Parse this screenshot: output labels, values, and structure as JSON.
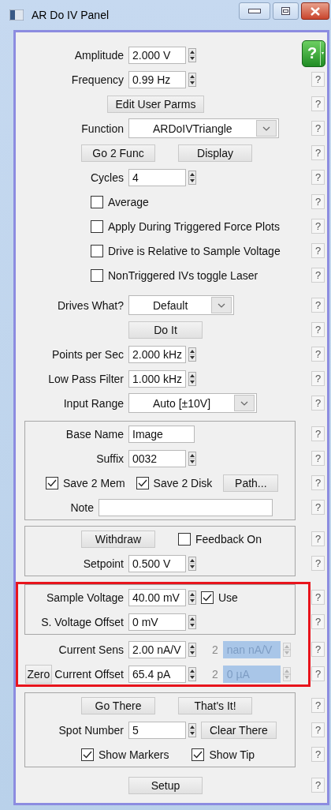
{
  "window": {
    "title": "AR Do IV Panel"
  },
  "blocks": [
    {
      "kind": "plain",
      "rows": [
        {
          "kind": "field",
          "lead": [
            {
              "kind": "label",
              "text": "Amplitude"
            }
          ],
          "items": [
            {
              "kind": "spin",
              "value": "2.000 V",
              "disabled": false
            }
          ],
          "help": {
            "kind": "green",
            "label": "?"
          }
        },
        {
          "kind": "field",
          "lead": [
            {
              "kind": "label",
              "text": "Frequency"
            }
          ],
          "items": [
            {
              "kind": "spin",
              "value": "0.99 Hz",
              "disabled": false
            }
          ],
          "help": {
            "kind": "small",
            "label": "?"
          }
        },
        {
          "kind": "center",
          "lead": [],
          "items": [
            {
              "kind": "button",
              "label": "Edit User Parms"
            }
          ],
          "help": {
            "kind": "small",
            "label": "?"
          }
        },
        {
          "kind": "field",
          "lead": [
            {
              "kind": "label",
              "text": "Function"
            }
          ],
          "items": [
            {
              "kind": "dropdown",
              "value": "ARDoIVTriangle"
            }
          ],
          "help": {
            "kind": "small",
            "label": "?"
          }
        },
        {
          "kind": "offset",
          "lead": [],
          "items": [
            {
              "kind": "button",
              "label": "Go 2 Func"
            },
            {
              "kind": "button",
              "label": "Display"
            }
          ],
          "help": {
            "kind": "small",
            "label": "?"
          }
        },
        {
          "kind": "field",
          "lead": [
            {
              "kind": "label",
              "text": "Cycles"
            }
          ],
          "items": [
            {
              "kind": "spin",
              "value": "4",
              "disabled": false
            }
          ],
          "help": {
            "kind": "small",
            "label": "?"
          }
        },
        {
          "kind": "check",
          "lead": [],
          "items": [
            {
              "kind": "checkbox",
              "label": "Average",
              "checked": false
            }
          ],
          "help": {
            "kind": "small",
            "label": "?"
          }
        },
        {
          "kind": "check",
          "lead": [],
          "items": [
            {
              "kind": "checkbox",
              "label": "Apply During Triggered Force Plots",
              "checked": false
            }
          ],
          "help": {
            "kind": "small",
            "label": "?"
          }
        },
        {
          "kind": "check",
          "lead": [],
          "items": [
            {
              "kind": "checkbox",
              "label": "Drive is Relative to Sample Voltage",
              "checked": false
            }
          ],
          "help": {
            "kind": "small",
            "label": "?"
          }
        },
        {
          "kind": "check",
          "lead": [],
          "items": [
            {
              "kind": "checkbox",
              "label": "NonTriggered IVs toggle Laser",
              "checked": false
            }
          ],
          "help": {
            "kind": "small",
            "label": "?"
          }
        }
      ]
    },
    {
      "kind": "plain",
      "rows": [
        {
          "kind": "field",
          "lead": [
            {
              "kind": "label",
              "text": "Drives What?"
            }
          ],
          "items": [
            {
              "kind": "dropdown",
              "value": "Default"
            }
          ],
          "help": {
            "kind": "small",
            "label": "?"
          }
        },
        {
          "kind": "field",
          "lead": [],
          "items": [
            {
              "kind": "button",
              "label": "Do It"
            }
          ],
          "help": {
            "kind": "small",
            "label": "?"
          }
        },
        {
          "kind": "field",
          "lead": [
            {
              "kind": "label",
              "text": "Points per Sec"
            }
          ],
          "items": [
            {
              "kind": "spin",
              "value": "2.000 kHz",
              "disabled": false
            }
          ],
          "help": {
            "kind": "small",
            "label": "?"
          }
        },
        {
          "kind": "field",
          "lead": [
            {
              "kind": "label",
              "text": "Low Pass Filter"
            }
          ],
          "items": [
            {
              "kind": "spin",
              "value": "1.000 kHz",
              "disabled": false
            }
          ],
          "help": {
            "kind": "small",
            "label": "?"
          }
        },
        {
          "kind": "field",
          "lead": [
            {
              "kind": "label",
              "text": "Input Range"
            }
          ],
          "items": [
            {
              "kind": "dropdown",
              "value": "Auto [±10V]"
            }
          ],
          "help": {
            "kind": "small",
            "label": "?"
          }
        }
      ]
    },
    {
      "kind": "frame",
      "rows": [
        {
          "kind": "field",
          "lead": [
            {
              "kind": "label",
              "text": "Base Name"
            }
          ],
          "items": [
            {
              "kind": "text",
              "value": "Image"
            }
          ],
          "help": {
            "kind": "small",
            "label": "?"
          }
        },
        {
          "kind": "field",
          "lead": [
            {
              "kind": "label",
              "text": "Suffix"
            }
          ],
          "items": [
            {
              "kind": "spin",
              "value": "0032",
              "disabled": false
            }
          ],
          "help": {
            "kind": "small",
            "label": "?"
          }
        },
        {
          "kind": "wide",
          "lead": [],
          "items": [
            {
              "kind": "checkbox",
              "label": "Save 2 Mem",
              "checked": true
            },
            {
              "kind": "checkbox",
              "label": "Save 2 Disk",
              "checked": true
            },
            {
              "kind": "button",
              "label": "Path..."
            }
          ],
          "help": {
            "kind": "small",
            "label": "?"
          }
        },
        {
          "kind": "short",
          "lead": [
            {
              "kind": "label",
              "text": "Note"
            }
          ],
          "items": [
            {
              "kind": "text",
              "value": ""
            }
          ],
          "help": {
            "kind": "small",
            "label": "?"
          }
        }
      ]
    },
    {
      "kind": "frame",
      "rows": [
        {
          "kind": "offset",
          "lead": [],
          "items": [
            {
              "kind": "button",
              "label": "Withdraw"
            },
            {
              "kind": "checkbox",
              "label": "Feedback On",
              "checked": false
            }
          ],
          "help": {
            "kind": "small",
            "label": "?"
          }
        },
        {
          "kind": "field",
          "lead": [
            {
              "kind": "label",
              "text": "Setpoint"
            }
          ],
          "items": [
            {
              "kind": "spin",
              "value": "0.500 V",
              "disabled": false
            }
          ],
          "help": {
            "kind": "small",
            "label": "?"
          }
        }
      ]
    },
    {
      "kind": "highlight",
      "blocks": [
        {
          "kind": "frame",
          "rows": [
            {
              "kind": "field",
              "lead": [
                {
                  "kind": "label",
                  "text": "Sample Voltage"
                }
              ],
              "items": [
                {
                  "kind": "spin",
                  "value": "40.00 mV",
                  "disabled": false
                },
                {
                  "kind": "checkbox",
                  "label": "Use",
                  "checked": true
                }
              ],
              "help": {
                "kind": "small",
                "label": "?"
              }
            },
            {
              "kind": "field",
              "lead": [
                {
                  "kind": "label",
                  "text": "S. Voltage Offset"
                }
              ],
              "items": [
                {
                  "kind": "spin",
                  "value": "0 mV",
                  "disabled": false
                }
              ],
              "help": {
                "kind": "small",
                "label": "?"
              }
            }
          ]
        },
        {
          "kind": "plain",
          "rows": [
            {
              "kind": "field",
              "lead": [
                {
                  "kind": "label",
                  "text": "Current Sens"
                }
              ],
              "items": [
                {
                  "kind": "spin",
                  "value": "2.00 nA/V",
                  "disabled": false
                },
                {
                  "kind": "index",
                  "text": "2"
                },
                {
                  "kind": "spin",
                  "value": "nan nA/V",
                  "disabled": true
                }
              ],
              "help": {
                "kind": "small",
                "label": "?"
              }
            },
            {
              "kind": "field",
              "lead": [
                {
                  "kind": "button",
                  "label": "Zero"
                },
                {
                  "kind": "label",
                  "text": "Current Offset"
                }
              ],
              "items": [
                {
                  "kind": "spin",
                  "value": "65.4 pA",
                  "disabled": false
                },
                {
                  "kind": "index",
                  "text": "2"
                },
                {
                  "kind": "spin",
                  "value": "0 µA",
                  "disabled": true
                }
              ],
              "help": {
                "kind": "small",
                "label": "?"
              }
            }
          ]
        }
      ]
    },
    {
      "kind": "frame",
      "rows": [
        {
          "kind": "offset",
          "lead": [],
          "items": [
            {
              "kind": "button",
              "label": "Go There"
            },
            {
              "kind": "button",
              "label": "That's It!"
            }
          ],
          "help": {
            "kind": "small",
            "label": "?"
          }
        },
        {
          "kind": "field",
          "lead": [
            {
              "kind": "label",
              "text": "Spot Number"
            }
          ],
          "items": [
            {
              "kind": "spin",
              "value": "5",
              "disabled": false
            },
            {
              "kind": "button",
              "label": "Clear There"
            }
          ],
          "help": {
            "kind": "small",
            "label": "?"
          }
        },
        {
          "kind": "offset",
          "lead": [],
          "items": [
            {
              "kind": "checkbox",
              "label": "Show Markers",
              "checked": true
            },
            {
              "kind": "checkbox",
              "label": "Show Tip",
              "checked": true
            }
          ],
          "help": {
            "kind": "small",
            "label": "?"
          }
        }
      ]
    },
    {
      "kind": "plain",
      "rows": [
        {
          "kind": "field",
          "lead": [],
          "items": [
            {
              "kind": "button",
              "label": "Setup"
            }
          ],
          "help": {
            "kind": "small",
            "label": "?"
          }
        }
      ]
    }
  ]
}
